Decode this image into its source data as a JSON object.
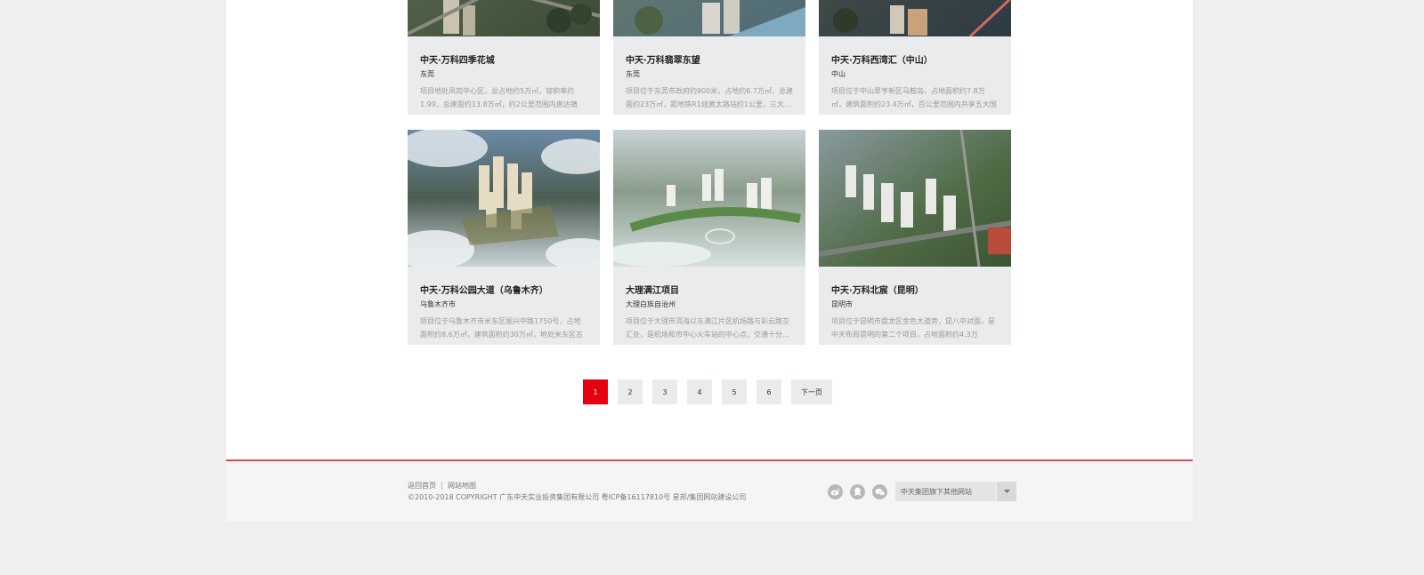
{
  "projects": [
    {
      "title": "中天·万科四季花城",
      "city": "东莞",
      "desc": "项目地处凤岗中心区，总占地约5万㎡，容积率约1.99，总建面约13.8万㎡，约2公里范围内直达镇政…"
    },
    {
      "title": "中天·万科翡翠东望",
      "city": "东莞",
      "desc": "项目位于东莞市政府约900米，占地约6.7万㎡，总建面约23万㎡，距地铁R1线黄太路站约1公里，三大…"
    },
    {
      "title": "中天·万科西湾汇（中山）",
      "city": "中山",
      "desc": "项目位于中山翠亨新区马鞍岛，占地面积约7.8万㎡，建筑面积约23.4万㎡，百公里范围内共享五大国际…"
    },
    {
      "title": "中天·万科公园大道（乌鲁木齐）",
      "city": "乌鲁木齐市",
      "desc": "项目位于乌鲁木齐市米东区振兴中路1750号，占地面积约8.6万㎡，建筑面积约30万㎡，地处米东区古牧…"
    },
    {
      "title": "大理满江项目",
      "city": "大理白族自治州",
      "desc": "项目位于大理市洱海以东满江片区机场路与彩云路交汇处，是机场和市中心火车站的中心点，交通十分…"
    },
    {
      "title": "中天·万科北宸（昆明）",
      "city": "昆明市",
      "desc": "项目位于昆明市盘龙区金色大道旁，昆八中对面，是中天布局昆明的第二个项目，占地面积约4.3万㎡，…"
    }
  ],
  "pagination": {
    "pages": [
      "1",
      "2",
      "3",
      "4",
      "5",
      "6"
    ],
    "active": "1",
    "next_label": "下一页"
  },
  "footer": {
    "home_link": "返回首页",
    "sitemap_link": "网站地图",
    "copyright": "©2010-2018 COPYRIGHT 广东中天实业投资集团有限公司 粤ICP备16117810号 星邦/集团网站建设公司",
    "socials": [
      "weibo-icon",
      "qq-icon",
      "wechat-icon"
    ],
    "site_select": "中天集团旗下其他网站"
  },
  "colors": {
    "accent": "#e3000f",
    "footer_line": "#d34a55",
    "card_bg": "#eaebec"
  }
}
